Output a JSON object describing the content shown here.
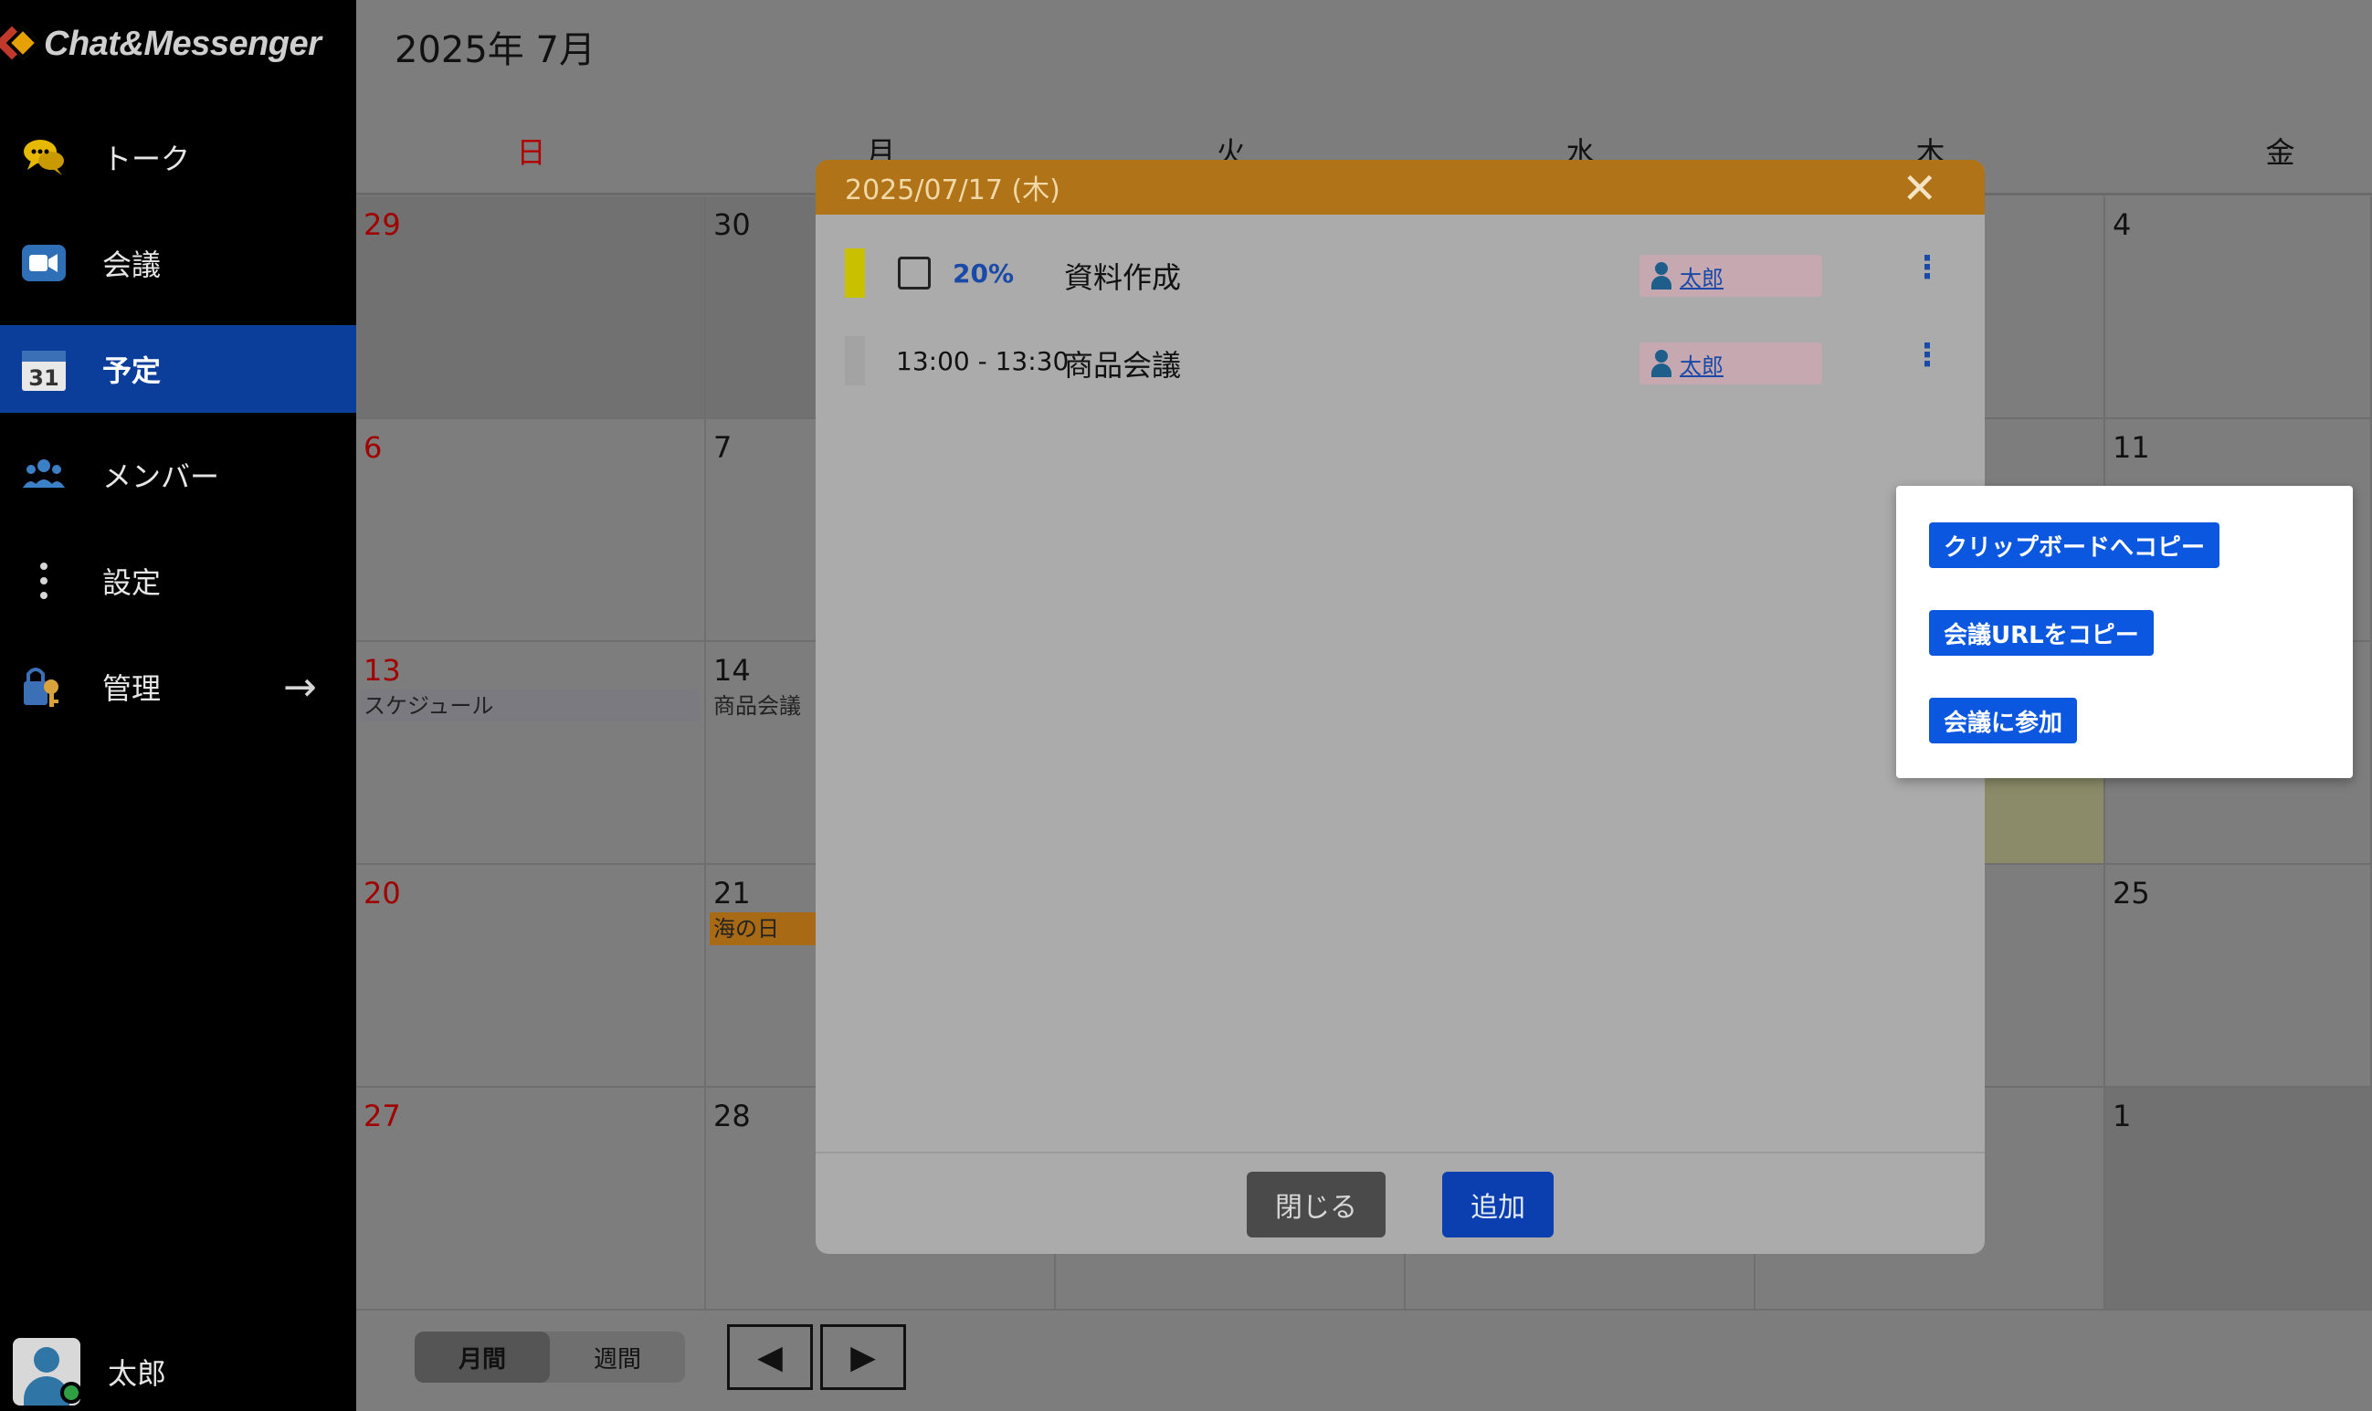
{
  "app": {
    "logo_text": "Chat&Messenger"
  },
  "sidebar": {
    "items": [
      {
        "label": "トーク",
        "icon": "chat-bubbles-icon"
      },
      {
        "label": "会議",
        "icon": "video-camera-icon"
      },
      {
        "label": "予定",
        "icon": "calendar-31-icon",
        "active": true
      },
      {
        "label": "メンバー",
        "icon": "members-icon"
      },
      {
        "label": "設定",
        "icon": "more-vertical-icon"
      },
      {
        "label": "管理",
        "icon": "key-lock-icon"
      }
    ],
    "calendar_icon_text": "31",
    "user_name": "太郎"
  },
  "calendar": {
    "title": "2025年 7月",
    "weekdays": [
      "日",
      "月",
      "火",
      "水",
      "木",
      "金"
    ],
    "weeks": [
      [
        "29",
        "30",
        "",
        "",
        "",
        "4"
      ],
      [
        "6",
        "7",
        "",
        "",
        "",
        "11"
      ],
      [
        "13",
        "14",
        "",
        "",
        "",
        ""
      ],
      [
        "20",
        "21",
        "",
        "",
        "",
        "25"
      ],
      [
        "27",
        "28",
        "",
        "",
        "",
        "1"
      ]
    ],
    "events": {
      "schedule": "スケジュール",
      "meeting": "商品会議",
      "holiday": "海の日"
    },
    "view_month": "月間",
    "view_week": "週間",
    "prev": "◀",
    "next": "▶"
  },
  "modal": {
    "date": "2025/07/17 (木)",
    "close_glyph": "✕",
    "rows": [
      {
        "percent": "20%",
        "title": "資料作成",
        "owner": "太郎",
        "bar_color": "#c9c000"
      },
      {
        "time": "13:00 - 13:30",
        "title": "商品会議",
        "owner": "太郎",
        "bar_color": "#a3a3a3"
      }
    ],
    "more_glyph": "⋮",
    "close_label": "閉じる",
    "add_label": "追加"
  },
  "menu": {
    "copy_clipboard": "クリップボードへコピー",
    "copy_url": "会議URLをコピー",
    "join": "会議に参加"
  }
}
